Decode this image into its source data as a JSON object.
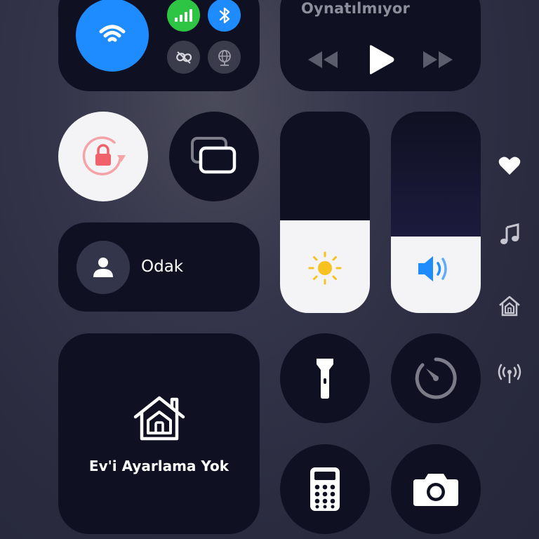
{
  "media": {
    "status": "Oynatılmıyor"
  },
  "focus": {
    "label": "Odak"
  },
  "home": {
    "label": "Ev'i Ayarlama Yok"
  },
  "sliders": {
    "brightness_level": 0.46,
    "volume_level": 0.38
  },
  "connectivity": {
    "wifi": "on",
    "cellular": "on",
    "bluetooth": "on",
    "airplay_link": "off",
    "hotspot": "off"
  },
  "side_icons": [
    "heart-icon",
    "music-note-icon",
    "home-icon",
    "antenna-icon"
  ],
  "colors": {
    "wifi_blue": "#1e8bff",
    "cellular_green": "#2ec545",
    "bluetooth_blue": "#1e8bff",
    "lock_red": "#f0616a",
    "sun_yellow": "#f7c21f",
    "speaker_blue": "#1e8bff"
  }
}
